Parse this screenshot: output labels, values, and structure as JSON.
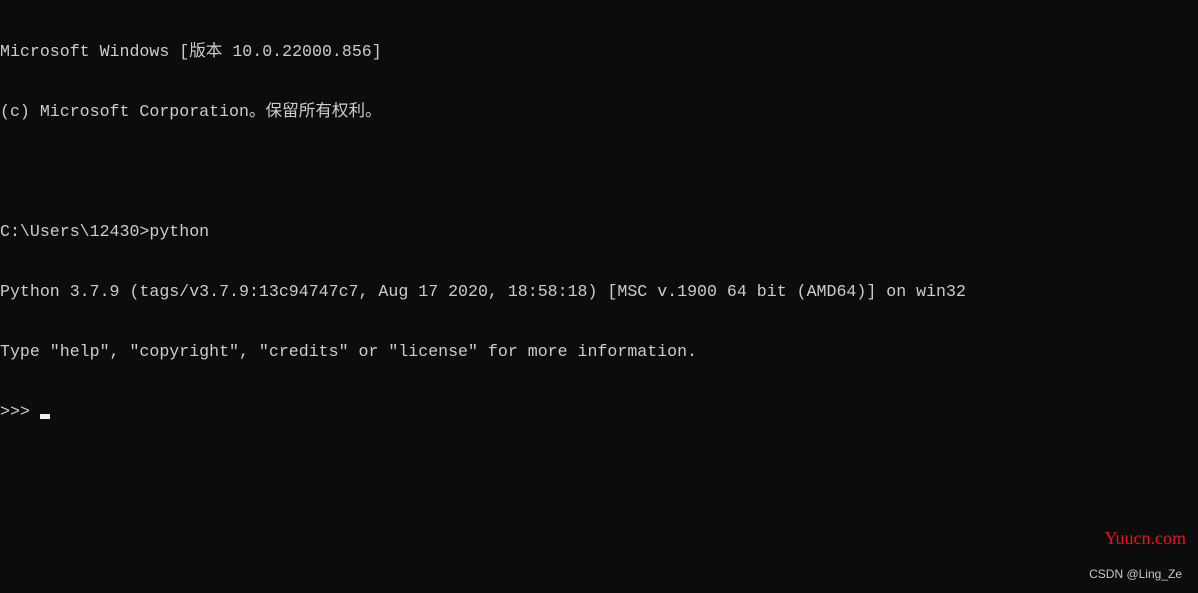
{
  "console": {
    "lines": [
      "Microsoft Windows [版本 10.0.22000.856]",
      "(c) Microsoft Corporation。保留所有权利。",
      "",
      "C:\\Users\\12430>python",
      "Python 3.7.9 (tags/v3.7.9:13c94747c7, Aug 17 2020, 18:58:18) [MSC v.1900 64 bit (AMD64)] on win32",
      "Type \"help\", \"copyright\", \"credits\" or \"license\" for more information."
    ],
    "prompt": ">>>"
  },
  "watermarks": {
    "site": "Yuucn.com",
    "author": "CSDN @Ling_Ze"
  },
  "colors": {
    "background": "#0c0c0c",
    "text": "#cccccc",
    "site_watermark": "#e8141b"
  }
}
